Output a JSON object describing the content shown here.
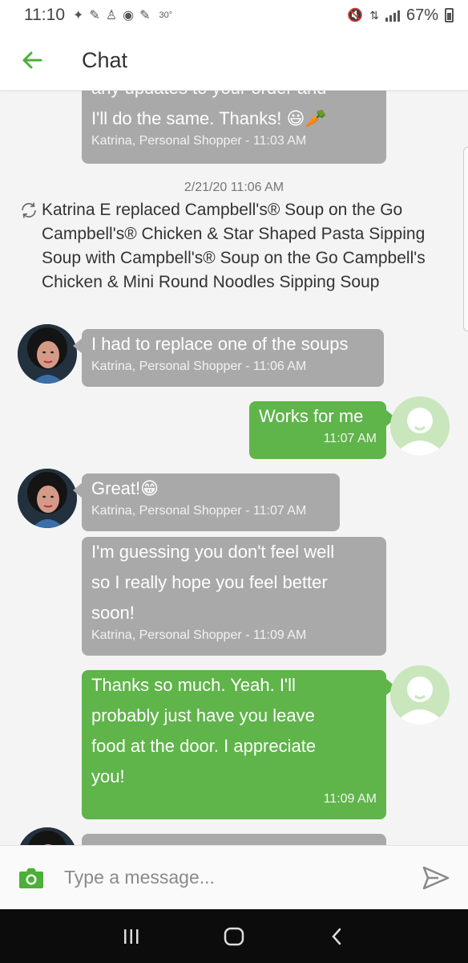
{
  "status_bar": {
    "time": "11:10",
    "temperature": "30°",
    "battery": "67%"
  },
  "app_bar": {
    "title": "Chat"
  },
  "colors": {
    "accent": "#4caf38",
    "incoming_bubble": "#a9a9a9",
    "outgoing_bubble": "#5fb44a"
  },
  "messages": [
    {
      "direction": "incoming",
      "text_lines": [
        "any updates to your order and",
        "I'll do the same. Thanks! 😃🥕"
      ],
      "meta": "Katrina, Personal Shopper - 11:03 AM"
    },
    {
      "direction": "incoming",
      "text": "I had to replace one of the soups",
      "meta": "Katrina, Personal Shopper - 11:06 AM"
    },
    {
      "direction": "outgoing",
      "text": "Works for me",
      "meta": "11:07 AM"
    },
    {
      "direction": "incoming",
      "text": "Great!😁",
      "meta": "Katrina, Personal Shopper - 11:07 AM"
    },
    {
      "direction": "incoming",
      "text_lines": [
        "I'm guessing you don't feel well",
        "so I really hope you feel better",
        "soon!"
      ],
      "meta": "Katrina, Personal Shopper - 11:09 AM"
    },
    {
      "direction": "outgoing",
      "text_lines": [
        "Thanks so much.  Yeah.  I'll",
        "probably just have you leave",
        "food at the door.  I appreciate",
        "you!"
      ],
      "meta": "11:09 AM"
    }
  ],
  "system_event": {
    "date": "2/21/20 11:06 AM",
    "text": "Katrina E replaced Campbell's® Soup on the Go Campbell's® Chicken & Star Shaped Pasta Sipping Soup with Campbell's® Soup on the Go Campbell's Chicken & Mini Round Noodles Sipping Soup",
    "icon": "replace-icon"
  },
  "composer": {
    "placeholder": "Type a message...",
    "camera_icon": "camera-icon",
    "send_icon": "send-icon"
  },
  "nav_bar": {
    "recents_icon": "recents-icon",
    "home_icon": "home-icon",
    "back_icon": "back-nav-icon"
  }
}
